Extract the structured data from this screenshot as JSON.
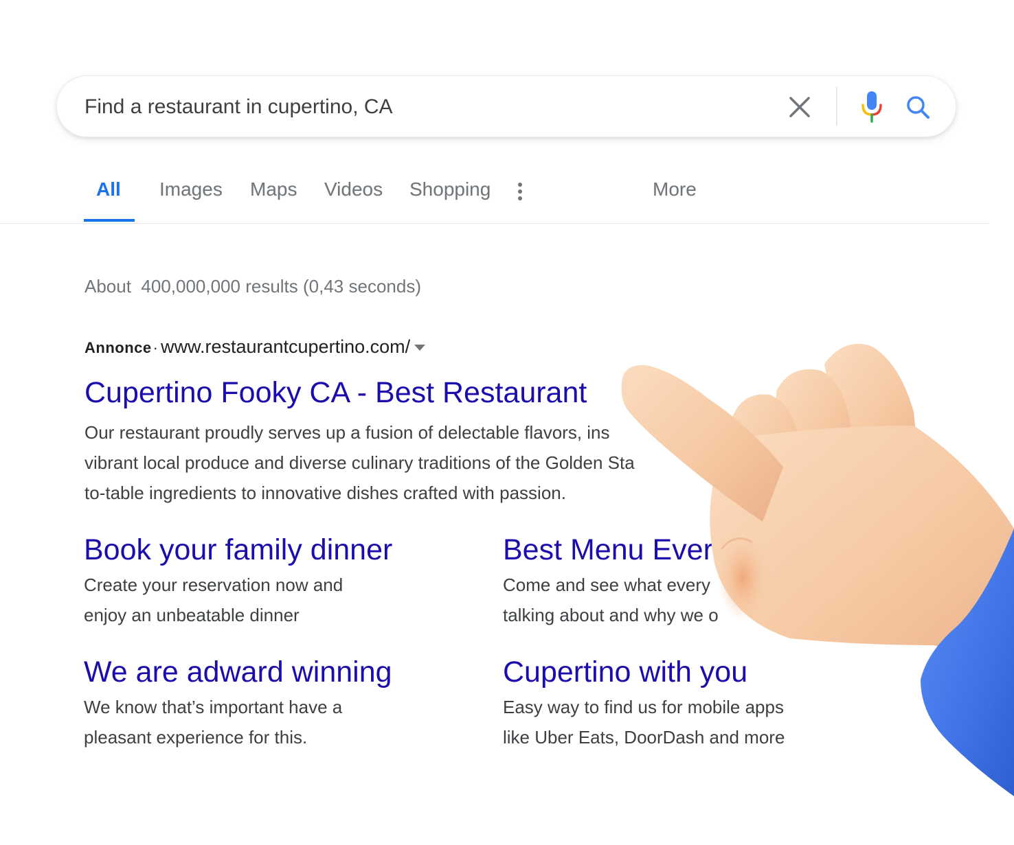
{
  "search": {
    "query": "Find a restaurant in cupertino, CA"
  },
  "tabs": [
    {
      "label": "All",
      "active": true
    },
    {
      "label": "Images",
      "active": false
    },
    {
      "label": "Maps",
      "active": false
    },
    {
      "label": "Videos",
      "active": false
    },
    {
      "label": "Shopping",
      "active": false
    }
  ],
  "more_label": "More",
  "results": {
    "stats": "About  400,000,000 results (0,43 seconds)",
    "ad": {
      "label": "Annonce",
      "separator": "·",
      "url": "www.restaurantcupertino.com/",
      "title": "Cupertino Fooky CA - Best Restaurant",
      "description_lines": [
        "Our restaurant proudly serves up a fusion of delectable flavors, ins",
        "vibrant local produce and diverse culinary traditions of the Golden Sta",
        "to-table ingredients to innovative dishes crafted with passion."
      ]
    },
    "sitelinks": [
      {
        "title": "Book your family dinner",
        "lines": [
          "Create your reservation now and",
          "enjoy an unbeatable dinner"
        ]
      },
      {
        "title": "Best Menu Ever",
        "lines": [
          "Come and see what every",
          "talking about and why we o"
        ]
      },
      {
        "title": "We are adward winning",
        "lines": [
          "We know that’s important have a",
          "pleasant experience for this."
        ]
      },
      {
        "title": "Cupertino with you",
        "lines": [
          "Easy way to find us for mobile apps",
          "like Uber Eats, DoorDash and more"
        ]
      }
    ]
  },
  "icons": {
    "clear": "close-icon",
    "mic": "microphone-icon",
    "search": "search-icon",
    "more": "more-vert-icon"
  },
  "colors": {
    "accent_blue": "#1a73e8",
    "link": "#1a0dab",
    "text": "#3c4043",
    "muted": "#70757a",
    "sleeve": "#3f73e6",
    "skin": "#f6c9a3"
  }
}
